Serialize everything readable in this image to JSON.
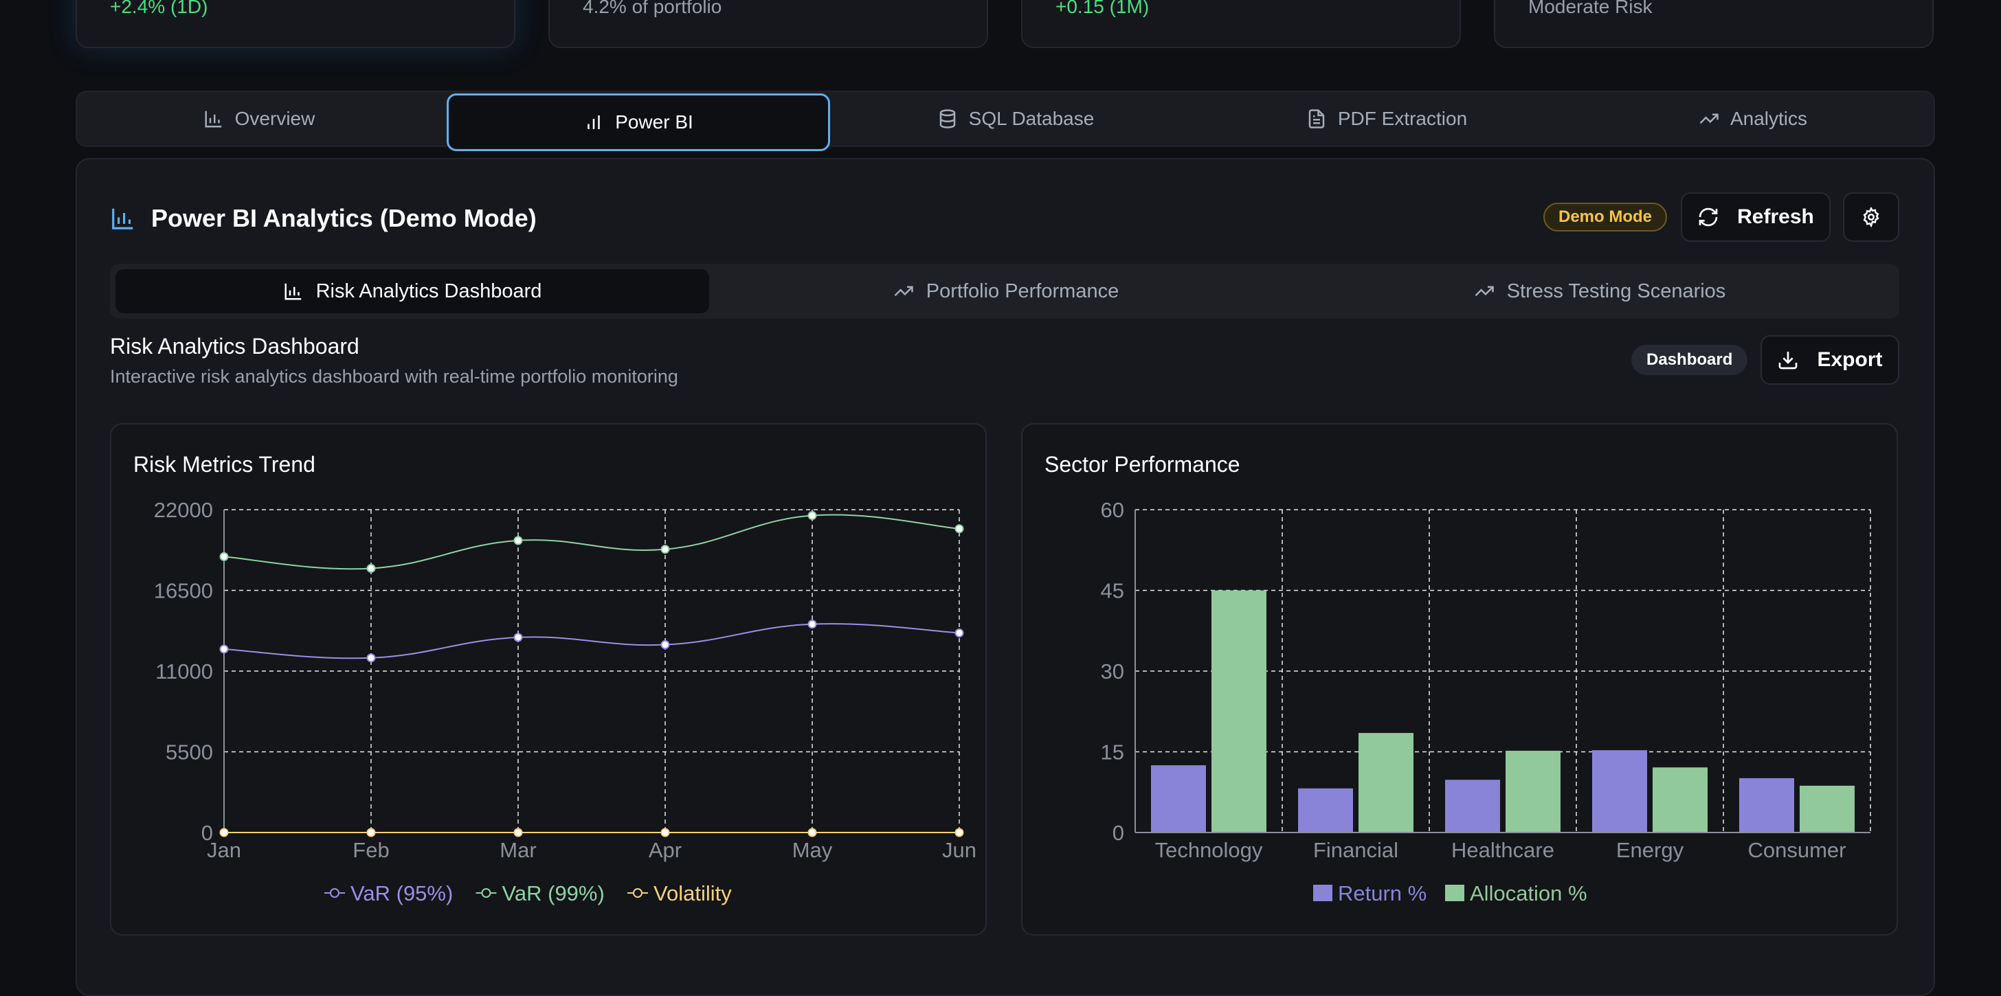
{
  "stat_cards": [
    {
      "text": "+2.4% (1D)",
      "tone": "green"
    },
    {
      "text": "4.2% of portfolio",
      "tone": "muted"
    },
    {
      "text": "+0.15 (1M)",
      "tone": "green"
    },
    {
      "text": "Moderate Risk",
      "tone": "muted"
    }
  ],
  "main_tabs": [
    {
      "label": "Overview",
      "icon": "bar-chart-icon"
    },
    {
      "label": "Power BI",
      "icon": "bar-chart-2-icon",
      "active": true
    },
    {
      "label": "SQL Database",
      "icon": "database-icon"
    },
    {
      "label": "PDF Extraction",
      "icon": "file-text-icon"
    },
    {
      "label": "Analytics",
      "icon": "trending-up-icon"
    }
  ],
  "panel": {
    "title": "Power BI Analytics (Demo Mode)",
    "badge": "Demo Mode",
    "refresh_label": "Refresh"
  },
  "sub_tabs": [
    {
      "label": "Risk Analytics Dashboard",
      "icon": "bar-chart-icon",
      "active": true
    },
    {
      "label": "Portfolio Performance",
      "icon": "trending-up-icon"
    },
    {
      "label": "Stress Testing Scenarios",
      "icon": "trending-up-icon"
    }
  ],
  "dashboard": {
    "title": "Risk Analytics Dashboard",
    "subtitle": "Interactive risk analytics dashboard with real-time portfolio monitoring",
    "badge": "Dashboard",
    "export_label": "Export"
  },
  "colors": {
    "var95": "#9b8fe6",
    "var99": "#8fd3a3",
    "volatility": "#f5d27a",
    "return": "#8a84d8",
    "allocation": "#92c99a",
    "accent_blue": "#5fb0f0"
  },
  "chart_data": [
    {
      "type": "line",
      "title": "Risk Metrics Trend",
      "x": [
        "Jan",
        "Feb",
        "Mar",
        "Apr",
        "May",
        "Jun"
      ],
      "yticks": [
        "0",
        "5500",
        "11000",
        "16500",
        "22000"
      ],
      "ylim": [
        0,
        22000
      ],
      "grid": true,
      "legend": "bottom",
      "series": [
        {
          "name": "VaR (95%)",
          "values": [
            12500,
            11900,
            13300,
            12800,
            14200,
            13600
          ]
        },
        {
          "name": "VaR (99%)",
          "values": [
            18800,
            18000,
            19900,
            19300,
            21600,
            20700
          ]
        },
        {
          "name": "Volatility",
          "values": [
            0,
            0,
            0,
            0,
            0,
            0
          ]
        }
      ]
    },
    {
      "type": "bar",
      "title": "Sector Performance",
      "categories": [
        "Technology",
        "Financial",
        "Healthcare",
        "Energy",
        "Consumer"
      ],
      "yticks": [
        "0",
        "15",
        "30",
        "45",
        "60"
      ],
      "ylim": [
        0,
        60
      ],
      "grid": true,
      "legend": "bottom",
      "series": [
        {
          "name": "Return %",
          "values": [
            12.5,
            8.2,
            9.8,
            15.3,
            10.1
          ]
        },
        {
          "name": "Allocation %",
          "values": [
            45,
            18.5,
            15.2,
            12.1,
            8.7
          ]
        }
      ]
    }
  ]
}
